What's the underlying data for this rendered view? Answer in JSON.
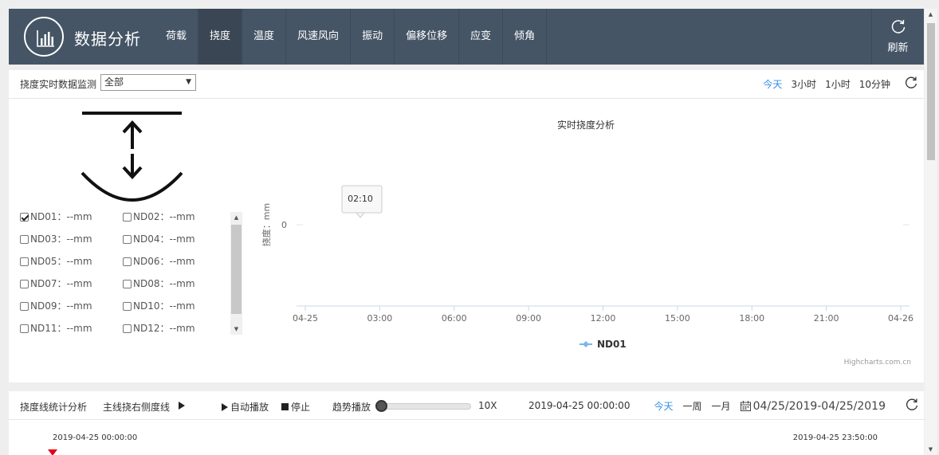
{
  "header": {
    "app_title": "数据分析",
    "nav": [
      "荷载",
      "挠度",
      "温度",
      "风速风向",
      "振动",
      "偏移位移",
      "应变",
      "倾角"
    ],
    "active_nav": "挠度",
    "refresh_label": "刷新",
    "logo_icon": "bar-chart-icon",
    "background": "#455566"
  },
  "monitor": {
    "label": "挠度实时数据监测",
    "select_value": "全部",
    "select_arrow": "▼",
    "range_tabs": [
      "今天",
      "3小时",
      "1小时",
      "10分钟"
    ],
    "active_range": "今天",
    "accent_color": "#2f8fe8"
  },
  "sensors": [
    {
      "label": "ND01：--mm",
      "checked": true
    },
    {
      "label": "ND02：--mm",
      "checked": false
    },
    {
      "label": "ND03：--mm",
      "checked": false
    },
    {
      "label": "ND04：--mm",
      "checked": false
    },
    {
      "label": "ND05：--mm",
      "checked": false
    },
    {
      "label": "ND06：--mm",
      "checked": false
    },
    {
      "label": "ND07：--mm",
      "checked": false
    },
    {
      "label": "ND08：--mm",
      "checked": false
    },
    {
      "label": "ND09：--mm",
      "checked": false
    },
    {
      "label": "ND10：--mm",
      "checked": false
    },
    {
      "label": "ND11：--mm",
      "checked": false
    },
    {
      "label": "ND12：--mm",
      "checked": false
    }
  ],
  "chart_data": {
    "type": "line",
    "title": "实时挠度分析",
    "ylabel": "挠度：mm",
    "y_ticks": [
      "0"
    ],
    "x_ticks": [
      "04-25",
      "03:00",
      "06:00",
      "09:00",
      "12:00",
      "15:00",
      "18:00",
      "21:00",
      "04-26"
    ],
    "series": [
      {
        "name": "ND01",
        "values": [],
        "color": "#7cb5ec"
      }
    ],
    "tooltip": "02:10",
    "credits": "Highcharts.com.cn",
    "grid": false,
    "legend_position": "bottom-center"
  },
  "stats": {
    "title": "挠度线统计分析",
    "line_label": "主线挠右侧度线",
    "auto_play": "自动播放",
    "stop": "停止",
    "trend_play": "趋势播放",
    "speed": "10X",
    "current_time": "2019-04-25 00:00:00",
    "range_tabs": [
      "今天",
      "一周",
      "一月"
    ],
    "active_range": "今天",
    "date_range": "04/25/2019-04/25/2019",
    "timeline_start": "2019-04-25 00:00:00",
    "timeline_end": "2019-04-25 23:50:00",
    "marker_color": "#e4001b"
  },
  "page_scroll": {
    "up": "▲",
    "down": "▼"
  }
}
